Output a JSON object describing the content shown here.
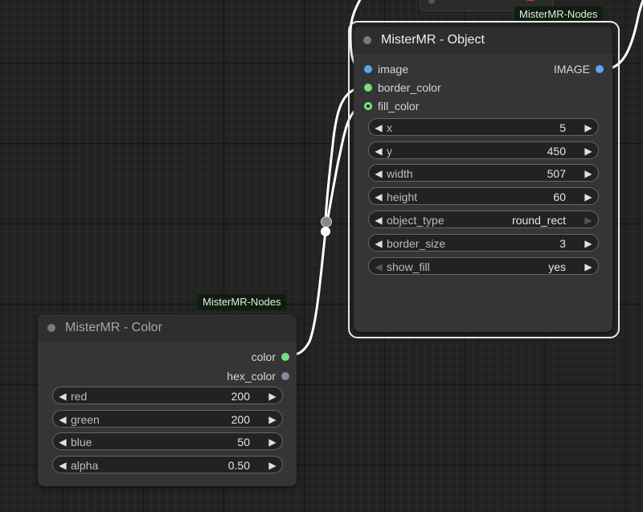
{
  "object_node": {
    "badge": "MisterMR-Nodes",
    "title": "MisterMR - Object",
    "inputs": [
      "image",
      "border_color",
      "fill_color"
    ],
    "output": "IMAGE",
    "widgets": [
      {
        "label": "x",
        "value": "5"
      },
      {
        "label": "y",
        "value": "450"
      },
      {
        "label": "width",
        "value": "507"
      },
      {
        "label": "height",
        "value": "60"
      },
      {
        "label": "object_type",
        "value": "round_rect"
      },
      {
        "label": "border_size",
        "value": "3"
      },
      {
        "label": "show_fill",
        "value": "yes"
      }
    ]
  },
  "color_node": {
    "badge": "MisterMR-Nodes",
    "title": "MisterMR - Color",
    "outputs": [
      "color",
      "hex_color"
    ],
    "widgets": [
      {
        "label": "red",
        "value": "200"
      },
      {
        "label": "green",
        "value": "200"
      },
      {
        "label": "blue",
        "value": "50"
      },
      {
        "label": "alpha",
        "value": "0.50"
      }
    ]
  },
  "icons": {
    "left_arrow": "◀",
    "right_arrow": "▶"
  },
  "colors": {
    "canvas": "#222222",
    "node_body": "#353535",
    "image_pin": "#5aa6ef",
    "color_pin": "#78e07a",
    "link": "#ffffff"
  }
}
